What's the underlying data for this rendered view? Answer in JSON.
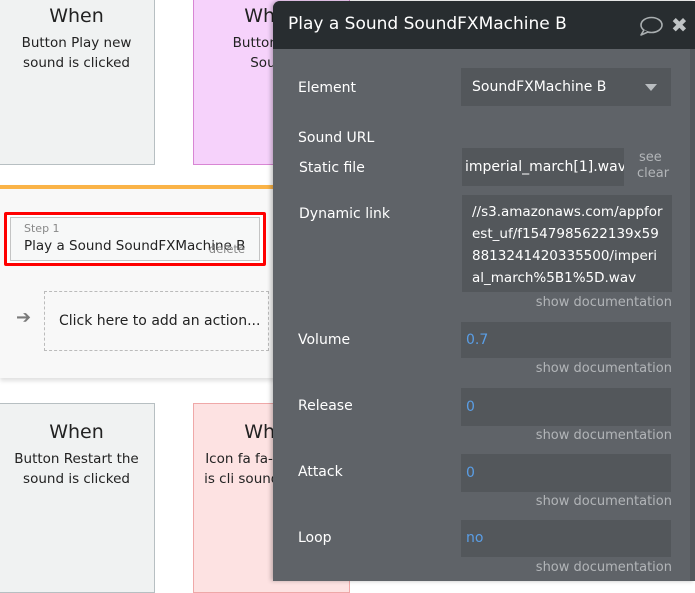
{
  "events": [
    {
      "when": "When",
      "description": "Button Play new sound is clicked",
      "style": "grey"
    },
    {
      "when": "When",
      "description": "Button Play Sound",
      "style": "pink"
    },
    {
      "when": "When",
      "description": "Button Restart the sound is clicked",
      "style": "grey"
    },
    {
      "when": "When",
      "description": "Icon fa fa-r sla is cli soundfx's",
      "style": "red"
    }
  ],
  "workflow": {
    "accent_color": "#fab347",
    "step": {
      "label": "Step 1",
      "title": "Play a Sound SoundFXMachine B",
      "delete_label": "delete",
      "highlight_color": "#ff0000"
    },
    "add_action_label": "Click here to add an action..."
  },
  "panel": {
    "title": "Play a Sound SoundFXMachine B",
    "icons": [
      "comment-icon",
      "close-icon"
    ],
    "element": {
      "label": "Element",
      "value": "SoundFXMachine B"
    },
    "sound_url": {
      "label": "Sound URL",
      "static_file": {
        "label": "Static file",
        "value": "imperial_march[1].wav",
        "see_label": "see",
        "clear_label": "clear"
      },
      "dynamic_link": {
        "label": "Dynamic link",
        "value": "//s3.amazonaws.com/appforest_uf/f1547985622139x598813241420335500/imperial_march%5B1%5D.wav"
      }
    },
    "volume": {
      "label": "Volume",
      "value": "0.7"
    },
    "release": {
      "label": "Release",
      "value": "0"
    },
    "attack": {
      "label": "Attack",
      "value": "0"
    },
    "loop": {
      "label": "Loop",
      "value": "no"
    },
    "doc_label": "show documentation",
    "value_color": "#5a9ee6"
  }
}
